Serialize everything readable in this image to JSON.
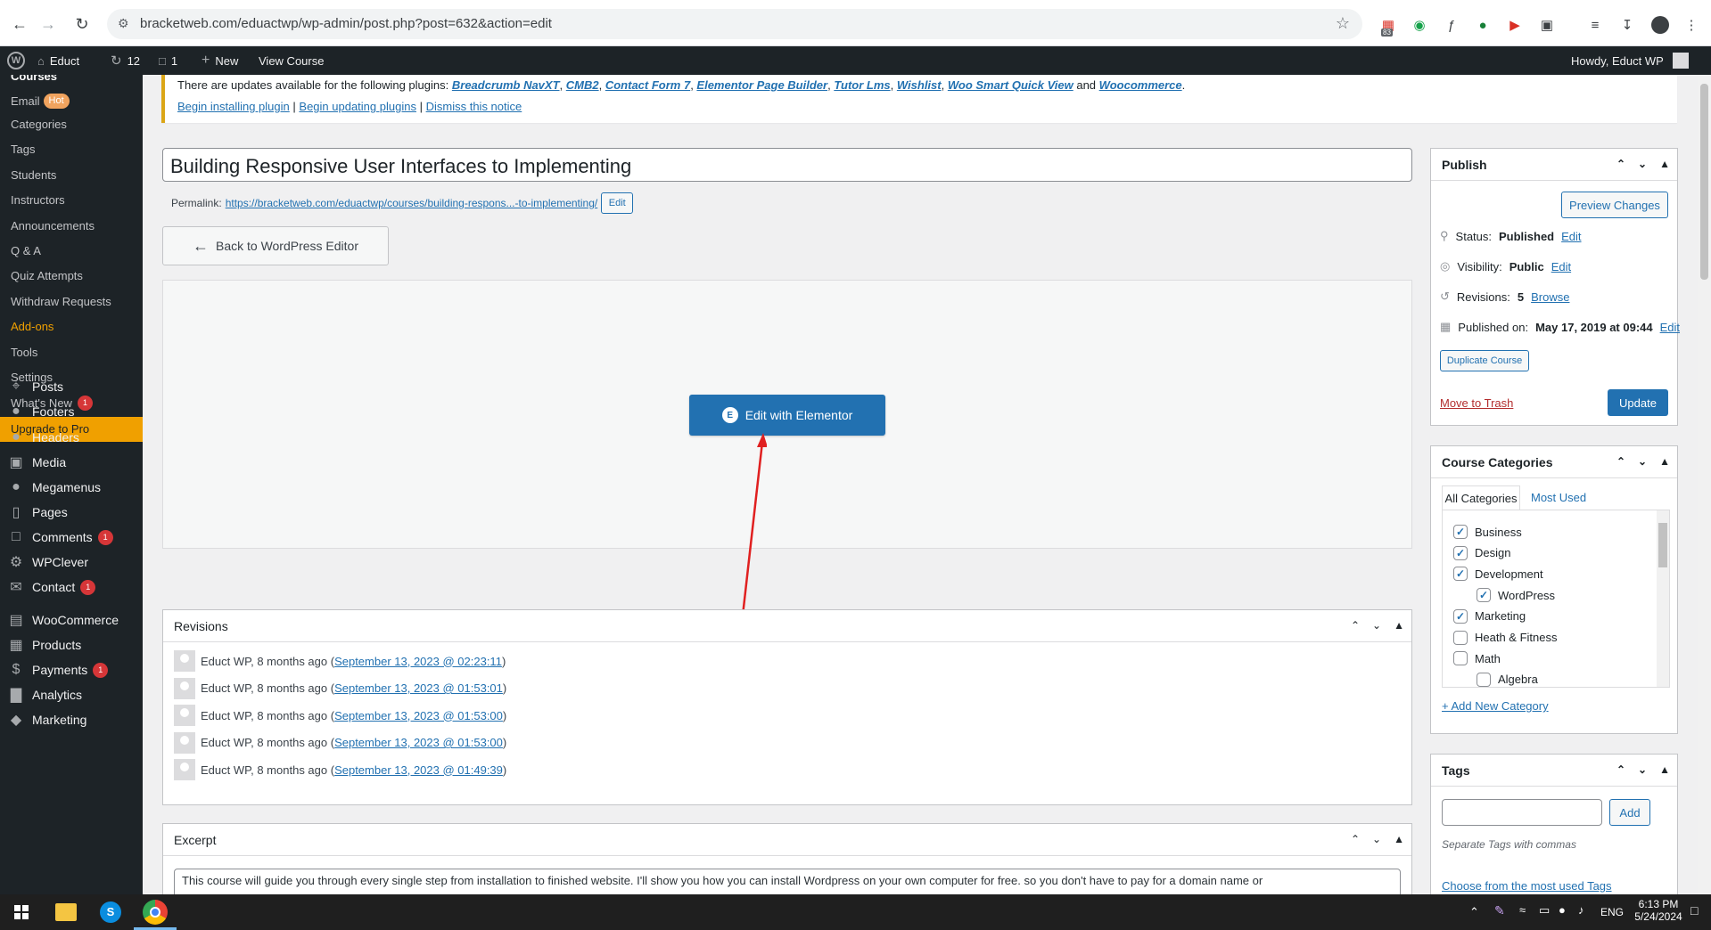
{
  "browser": {
    "url": "bracketweb.com/eduactwp/wp-admin/post.php?post=632&action=edit",
    "ext_badge": "83"
  },
  "adminbar": {
    "site": "Educt",
    "updates": "12",
    "comments": "1",
    "new": "New",
    "view": "View Course",
    "howdy": "Howdy, Educt WP"
  },
  "sidebar": {
    "section": "Courses",
    "email": "Email",
    "hot": "Hot",
    "sub_items": [
      "Categories",
      "Tags",
      "Students",
      "Instructors",
      "Announcements",
      "Q & A",
      "Quiz Attempts",
      "Withdraw Requests",
      "Add-ons",
      "Tools",
      "Settings"
    ],
    "whats_new": "What's New",
    "whats_new_badge": "1",
    "upgrade": "Upgrade to Pro",
    "main_items": [
      {
        "label": "Posts",
        "icon": "pin-icon"
      },
      {
        "label": "Footers",
        "icon": "bulb-icon"
      },
      {
        "label": "Headers",
        "icon": "bulb-icon"
      },
      {
        "label": "Media",
        "icon": "media-icon"
      },
      {
        "label": "Megamenus",
        "icon": "bulb-icon"
      },
      {
        "label": "Pages",
        "icon": "pages-icon"
      },
      {
        "label": "Comments",
        "icon": "comment-icon",
        "badge": "1"
      },
      {
        "label": "WPClever",
        "icon": "gear-icon"
      },
      {
        "label": "Contact",
        "icon": "mail-icon",
        "badge": "1"
      },
      {
        "label": "WooCommerce",
        "icon": "woo-icon"
      },
      {
        "label": "Products",
        "icon": "products-icon"
      },
      {
        "label": "Payments",
        "icon": "payments-icon",
        "badge": "1"
      },
      {
        "label": "Analytics",
        "icon": "analytics-icon"
      },
      {
        "label": "Marketing",
        "icon": "megaphone-icon"
      }
    ]
  },
  "notice": {
    "text_start": "There are updates available for the following plugins:",
    "plugins": [
      "Breadcrumb NavXT",
      "CMB2",
      "Contact Form 7",
      "Elementor Page Builder",
      "Tutor Lms",
      "Wishlist",
      "Woo Smart Quick View"
    ],
    "and": "and",
    "last_plugin": "Woocommerce",
    "begin_install": "Begin installing plugin",
    "begin_update": "Begin updating plugins",
    "dismiss": "Dismiss this notice",
    "sep": "|"
  },
  "editor": {
    "title": "Building Responsive User Interfaces to Implementing",
    "permalink_label": "Permalink:",
    "permalink_url": "https://bracketweb.com/eduactwp/courses/building-respons...-to-implementing/",
    "permalink_edit": "Edit",
    "back_button": "Back to WordPress Editor",
    "elementor_button": "Edit with Elementor"
  },
  "revisions": {
    "title": "Revisions",
    "items": [
      {
        "author": "Educt WP, 8 months ago (",
        "link": "September 13, 2023 @ 02:23:11",
        ")": ")"
      },
      {
        "author": "Educt WP, 8 months ago (",
        "link": "September 13, 2023 @ 01:53:01",
        ")": ")"
      },
      {
        "author": "Educt WP, 8 months ago (",
        "link": "September 13, 2023 @ 01:53:00",
        ")": ")"
      },
      {
        "author": "Educt WP, 8 months ago (",
        "link": "September 13, 2023 @ 01:53:00",
        ")": ")"
      },
      {
        "author": "Educt WP, 8 months ago (",
        "link": "September 13, 2023 @ 01:49:39",
        ")": ")"
      }
    ]
  },
  "excerpt": {
    "title": "Excerpt",
    "text": "This course will guide you through every single step from installation to finished website.  I'll show you how you can install Wordpress on your own computer for free. so you don't have to pay for a domain name or"
  },
  "publish": {
    "title": "Publish",
    "preview": "Preview Changes",
    "status_label": "Status:",
    "status_value": "Published",
    "visibility_label": "Visibility:",
    "visibility_value": "Public",
    "revisions_label": "Revisions:",
    "revisions_value": "5",
    "browse": "Browse",
    "published_label": "Published on:",
    "published_value": "May 17, 2019 at 09:44",
    "edit": "Edit",
    "duplicate": "Duplicate Course",
    "trash": "Move to Trash",
    "update": "Update"
  },
  "categories": {
    "title": "Course Categories",
    "tab_all": "All Categories",
    "tab_most": "Most Used",
    "items": [
      {
        "label": "Business",
        "checked": true,
        "indent": false
      },
      {
        "label": "Design",
        "checked": true,
        "indent": false
      },
      {
        "label": "Development",
        "checked": true,
        "indent": false
      },
      {
        "label": "WordPress",
        "checked": true,
        "indent": true
      },
      {
        "label": "Marketing",
        "checked": true,
        "indent": false
      },
      {
        "label": "Heath & Fitness",
        "checked": false,
        "indent": false
      },
      {
        "label": "Math",
        "checked": false,
        "indent": false
      },
      {
        "label": "Algebra",
        "checked": false,
        "indent": true
      }
    ],
    "add_new": "+ Add New Category"
  },
  "tags": {
    "title": "Tags",
    "add": "Add",
    "hint": "Separate Tags with commas",
    "choose": "Choose from the most used Tags"
  },
  "taskbar": {
    "time": "6:13 PM",
    "date": "5/24/2024",
    "lang": "ENG"
  },
  "colors": {
    "wp_dark": "#1d2327",
    "wp_blue": "#2271b1",
    "upgrade": "#f0a000",
    "elementor": "#2271b1"
  }
}
